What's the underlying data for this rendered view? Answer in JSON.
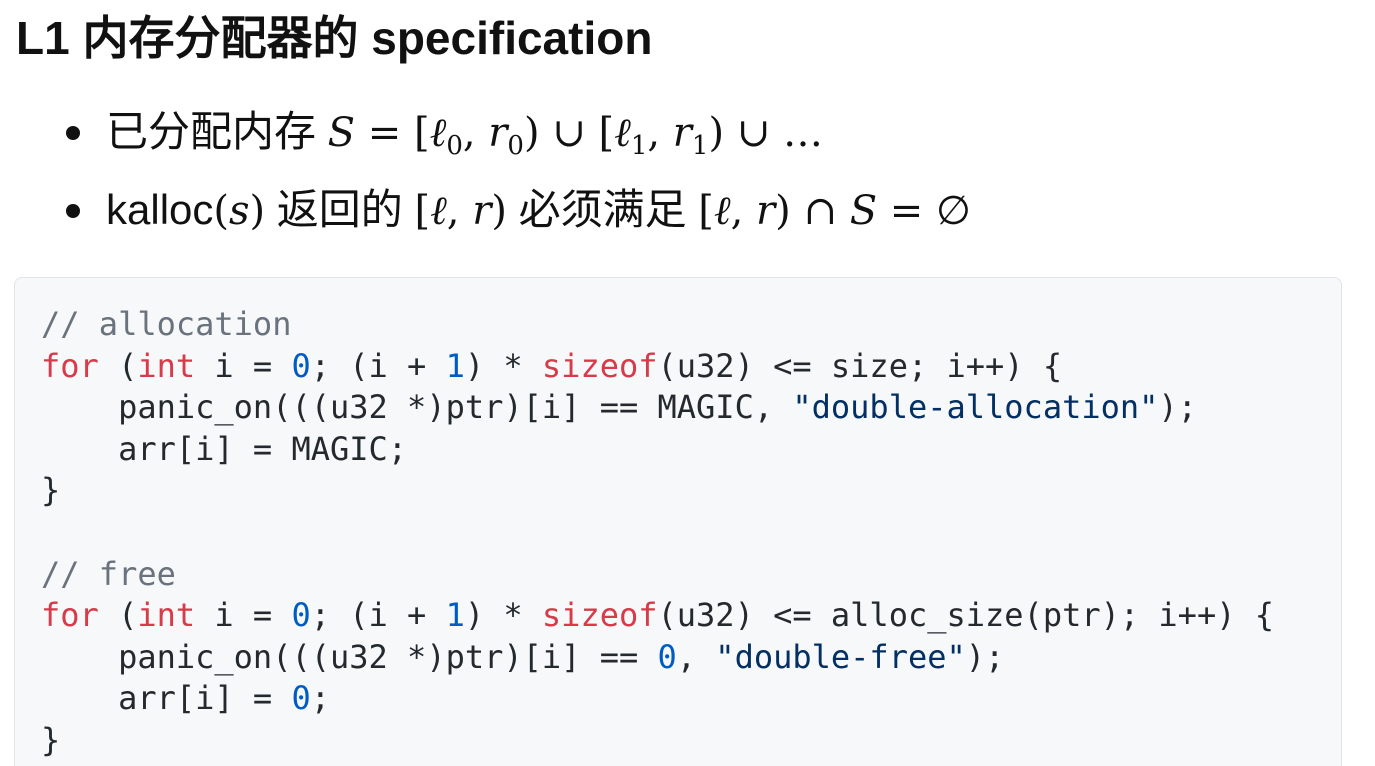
{
  "heading": {
    "prefix": "L1 内存分配器的 specification"
  },
  "bullets": [
    {
      "text_before": "已分配内存 ",
      "math": {
        "S": "S",
        "eq": " = ",
        "open1": "[",
        "l0": "ℓ",
        "sub0": "0",
        "comma1": ", ",
        "r0": "r",
        "rsub0": "0",
        "close1": ")",
        "cup1": " ∪ ",
        "open2": "[",
        "l1": "ℓ",
        "sub1": "1",
        "comma2": ", ",
        "r1": "r",
        "rsub1": "1",
        "close2": ")",
        "cup2": " ∪ ",
        "dots": "…"
      }
    },
    {
      "text_kalloc": "kalloc",
      "paren_open": "(",
      "s": "s",
      "paren_close": ")",
      "text_mid": " 返回的 ",
      "range1": {
        "open": "[",
        "l": "ℓ",
        "comma": ", ",
        "r": "r",
        "close": ")"
      },
      "text_must": " 必须满足 ",
      "range2": {
        "open": "[",
        "l": "ℓ",
        "comma": ", ",
        "r": "r",
        "close": ")"
      },
      "cap": " ∩ ",
      "S": "S",
      "eq": " = ",
      "empty": "∅"
    }
  ],
  "code": {
    "line1": {
      "comment": "// allocation"
    },
    "line2": {
      "t1": "for",
      "t2": " (",
      "t3": "int",
      "t4": " i = ",
      "t5": "0",
      "t6": "; (i + ",
      "t7": "1",
      "t8": ") * ",
      "t9": "sizeof",
      "t10": "(u32) <= size; i++) {"
    },
    "line3": {
      "t1": "    panic_on(((u32 *)ptr)[i] == MAGIC, ",
      "t2": "\"double-allocation\"",
      "t3": ");"
    },
    "line4": {
      "t1": "    arr[i] = MAGIC;"
    },
    "line5": {
      "t1": "}"
    },
    "line6": {
      "t1": ""
    },
    "line7": {
      "comment": "// free"
    },
    "line8": {
      "t1": "for",
      "t2": " (",
      "t3": "int",
      "t4": " i = ",
      "t5": "0",
      "t6": "; (i + ",
      "t7": "1",
      "t8": ") * ",
      "t9": "sizeof",
      "t10": "(u32) <= alloc_size(ptr); i++) {"
    },
    "line9": {
      "t1": "    panic_on(((u32 *)ptr)[i] == ",
      "t2": "0",
      "t3": ", ",
      "t4": "\"double-free\"",
      "t5": ");"
    },
    "line10": {
      "t1": "    arr[i] = ",
      "t2": "0",
      "t3": ";"
    },
    "line11": {
      "t1": "}"
    }
  }
}
